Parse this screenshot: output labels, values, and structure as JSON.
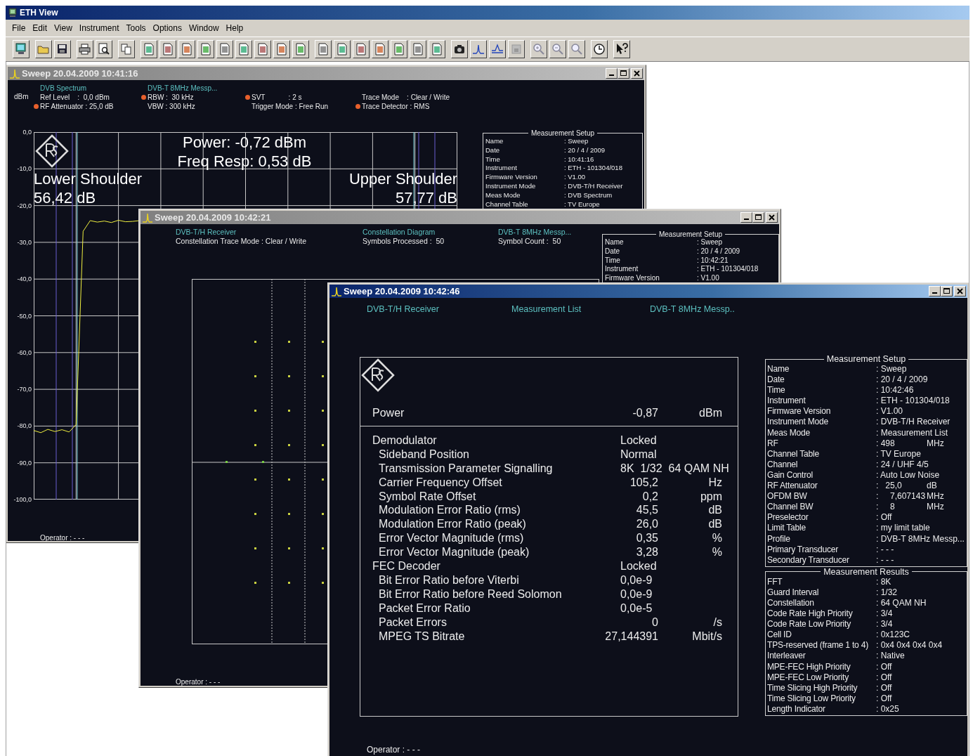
{
  "app": {
    "title": "ETH View"
  },
  "menu": [
    "File",
    "Edit",
    "View",
    "Instrument",
    "Tools",
    "Options",
    "Window",
    "Help"
  ],
  "windows": [
    {
      "kind": "spectrum",
      "title": "Sweep 20.04.2009 10:41:16",
      "active": false,
      "unit_label": "dBm",
      "header": [
        {
          "title": "DVB Spectrum",
          "lines": [
            {
              "text": "Ref Level    :  0,0 dBm",
              "marked": false
            },
            {
              "text": "RF Attenuator : 25,0 dB",
              "marked": true
            }
          ]
        },
        {
          "title": "DVB-T 8MHz Messp...",
          "lines": [
            {
              "text": "RBW :  30 kHz",
              "marked": true
            },
            {
              "text": "VBW : 300 kHz",
              "marked": false
            }
          ]
        },
        {
          "lines": [
            {
              "text": "SVT            : 2 s",
              "marked": true
            },
            {
              "text": "Trigger Mode : Free Run",
              "marked": false
            }
          ]
        },
        {
          "lines": [
            {
              "text": "Trace Mode    : Clear / Write",
              "marked": false
            },
            {
              "text": "Trace Detector : RMS",
              "marked": true
            }
          ]
        }
      ],
      "chart_data": {
        "type": "line",
        "ylim": [
          -100,
          0
        ],
        "grid": true,
        "yticks": [
          {
            "value": 0,
            "label": "0,0"
          },
          {
            "value": -10,
            "label": "-10,0"
          },
          {
            "value": -20,
            "label": "-20,0"
          },
          {
            "value": -30,
            "label": "-30,0"
          },
          {
            "value": -40,
            "label": "-40,0"
          },
          {
            "value": -50,
            "label": "-50,0"
          },
          {
            "value": -60,
            "label": "-60,0"
          },
          {
            "value": -70,
            "label": "-70,0"
          },
          {
            "value": -80,
            "label": "-80,0"
          },
          {
            "value": -90,
            "label": "-90,0"
          },
          {
            "value": -100,
            "label": "-100,0"
          }
        ],
        "series": [
          {
            "color": "#f0f040",
            "values": [
              -81.2,
              -81.8,
              -80.9,
              -81.5,
              -81.0,
              -81.6,
              -79.6,
              -27.0,
              -24.1,
              -24.5,
              -24.2,
              -24.6,
              -24.0,
              -24.4,
              -24.3,
              -24.1,
              null,
              null,
              null,
              null,
              null,
              null,
              null,
              null,
              null,
              null,
              null,
              null,
              null,
              null,
              null,
              null,
              null,
              null,
              null,
              null,
              null,
              null,
              null,
              null,
              null,
              null,
              null,
              null,
              null,
              null,
              null,
              null,
              null,
              null,
              null,
              null,
              null,
              null,
              null,
              null,
              null,
              null,
              null,
              null,
              null
            ]
          }
        ]
      },
      "overlay": {
        "power": "Power: -0,72 dBm",
        "freq_resp": "Freq Resp: 0,53 dB",
        "lower_label": "Lower Shoulder",
        "lower_value": "56,42 dB",
        "upper_label": "Upper Shoulder",
        "upper_value": "57,77 dB"
      },
      "setup": {
        "title": "Measurement Setup",
        "rows": [
          {
            "label": "Name",
            "value": ": Sweep"
          },
          {
            "label": "Date",
            "value": ": 20 / 4 / 2009"
          },
          {
            "label": "Time",
            "value": ": 10:41:16"
          },
          {
            "label": "Instrument",
            "value": ": ETH - 101304/018"
          },
          {
            "label": "Firmware Version",
            "value": ": V1.00"
          },
          {
            "label": "Instrument Mode",
            "value": ": DVB-T/H Receiver"
          },
          {
            "label": "Meas Mode",
            "value": ": DVB Spectrum"
          },
          {
            "label": "Channel Table",
            "value": ": TV Europe"
          }
        ]
      },
      "operator": "Operator : - - -"
    },
    {
      "kind": "constellation",
      "title": "Sweep 20.04.2009 10:42:21",
      "active": false,
      "header": [
        {
          "title": "DVB-T/H Receiver",
          "lines": [
            {
              "text": "Constellation Trace Mode : Clear / Write",
              "marked": false
            }
          ]
        },
        {
          "title": "Constellation Diagram",
          "lines": [
            {
              "text": "Symbols Processed :  50",
              "marked": false
            }
          ]
        },
        {
          "title": "DVB-T 8MHz Messp...",
          "lines": [
            {
              "text": "Symbol Count :  50",
              "marked": false
            }
          ]
        }
      ],
      "setup": {
        "title": "Measurement Setup",
        "rows": [
          {
            "label": "Name",
            "value": ": Sweep"
          },
          {
            "label": "Date",
            "value": ": 20 / 4 / 2009"
          },
          {
            "label": "Time",
            "value": ": 10:42:21"
          },
          {
            "label": "Instrument",
            "value": ": ETH - 101304/018"
          },
          {
            "label": "Firmware Version",
            "value": ": V1.00"
          }
        ]
      },
      "operator": "Operator : - - -"
    },
    {
      "kind": "list",
      "title": "Sweep 20.04.2009 10:42:46",
      "active": true,
      "header": [
        {
          "title": "DVB-T/H Receiver"
        },
        {
          "title": "Measurement List"
        },
        {
          "title": "DVB-T 8MHz Messp.."
        }
      ],
      "power": {
        "label": "Power",
        "value": "-0,87",
        "unit": "dBm"
      },
      "items": [
        {
          "label": "Demodulator",
          "value": "Locked",
          "children": [
            {
              "label": "Sideband Position",
              "value": "Normal"
            },
            {
              "label": "Transmission Parameter Signalling",
              "value": "8K  1/32  64 QAM NH"
            },
            {
              "label": "Carrier Frequency Offset",
              "value": "105,2",
              "unit": "Hz"
            },
            {
              "label": "Symbol Rate Offset",
              "value": "0,2",
              "unit": "ppm"
            },
            {
              "label": "Modulation Error Ratio (rms)",
              "value": "45,5",
              "unit": "dB"
            },
            {
              "label": "Modulation Error Ratio (peak)",
              "value": "26,0",
              "unit": "dB"
            },
            {
              "label": "Error Vector Magnitude (rms)",
              "value": "0,35",
              "unit": "%"
            },
            {
              "label": "Error Vector Magnitude (peak)",
              "value": "3,28",
              "unit": "%"
            }
          ]
        },
        {
          "label": "FEC Decoder",
          "value": "Locked",
          "children": [
            {
              "label": "Bit Error Ratio before Viterbi",
              "value": "0,0e-9"
            },
            {
              "label": "Bit Error Ratio before Reed Solomon",
              "value": "0,0e-9"
            },
            {
              "label": "Packet Error Ratio",
              "value": "0,0e-5"
            },
            {
              "label": "Packet Errors",
              "value": "0",
              "unit": "/s"
            },
            {
              "label": "MPEG TS Bitrate",
              "value": "27,144391",
              "unit": "Mbit/s"
            }
          ]
        }
      ],
      "setup": {
        "title": "Measurement Setup",
        "rows": [
          {
            "label": "Name",
            "value": ": Sweep"
          },
          {
            "label": "Date",
            "value": ": 20 / 4 / 2009"
          },
          {
            "label": "Time",
            "value": ": 10:42:46"
          },
          {
            "label": "Instrument",
            "value": ": ETH - 101304/018"
          },
          {
            "label": "Firmware Version",
            "value": ": V1.00"
          },
          {
            "label": "Instrument Mode",
            "value": ": DVB-T/H Receiver"
          },
          {
            "label": "Meas Mode",
            "value": ": Measurement List"
          },
          {
            "label": "RF",
            "value": ": 498",
            "unit": "MHz"
          },
          {
            "label": "Channel Table",
            "value": ": TV Europe"
          },
          {
            "label": "Channel",
            "value": ": 24 / UHF 4/5"
          },
          {
            "label": "Gain Control",
            "value": ": Auto Low Noise"
          },
          {
            "label": "RF Attenuator",
            "value": ":   25,0",
            "unit": "dB"
          },
          {
            "label": "OFDM BW",
            "value": ":     7,607143",
            "unit": "MHz"
          },
          {
            "label": "Channel BW",
            "value": ":     8",
            "unit": "MHz"
          },
          {
            "label": "Preselector",
            "value": ": Off"
          },
          {
            "label": "Limit Table",
            "value": ": my limit table"
          },
          {
            "label": "Profile",
            "value": ": DVB-T 8MHz Messp..."
          },
          {
            "label": "Primary Transducer",
            "value": ": - - -"
          },
          {
            "label": "Secondary Transducer",
            "value": ": - - -"
          }
        ]
      },
      "results": {
        "title": "Measurement Results",
        "rows": [
          {
            "label": "FFT",
            "value": ": 8K"
          },
          {
            "label": "Guard Interval",
            "value": ": 1/32"
          },
          {
            "label": "Constellation",
            "value": ": 64 QAM NH"
          },
          {
            "label": "Code Rate High Priority",
            "value": ": 3/4"
          },
          {
            "label": "Code Rate Low Priority",
            "value": ": 3/4"
          },
          {
            "label": "Cell ID",
            "value": ": 0x123C"
          },
          {
            "label": "TPS-reserved (frame 1 to 4)",
            "value": ": 0x4 0x4 0x4 0x4"
          },
          {
            "label": "Interleaver",
            "value": ": Native"
          },
          {
            "label": "MPE-FEC High Priority",
            "value": ": Off"
          },
          {
            "label": "MPE-FEC Low Priority",
            "value": ": Off"
          },
          {
            "label": "Time Slicing High Priority",
            "value": ": Off"
          },
          {
            "label": "Time Slicing Low Priority",
            "value": ": Off"
          },
          {
            "label": "Length Indicator",
            "value": ": 0x25"
          }
        ]
      },
      "operator": "Operator : - - -"
    }
  ]
}
